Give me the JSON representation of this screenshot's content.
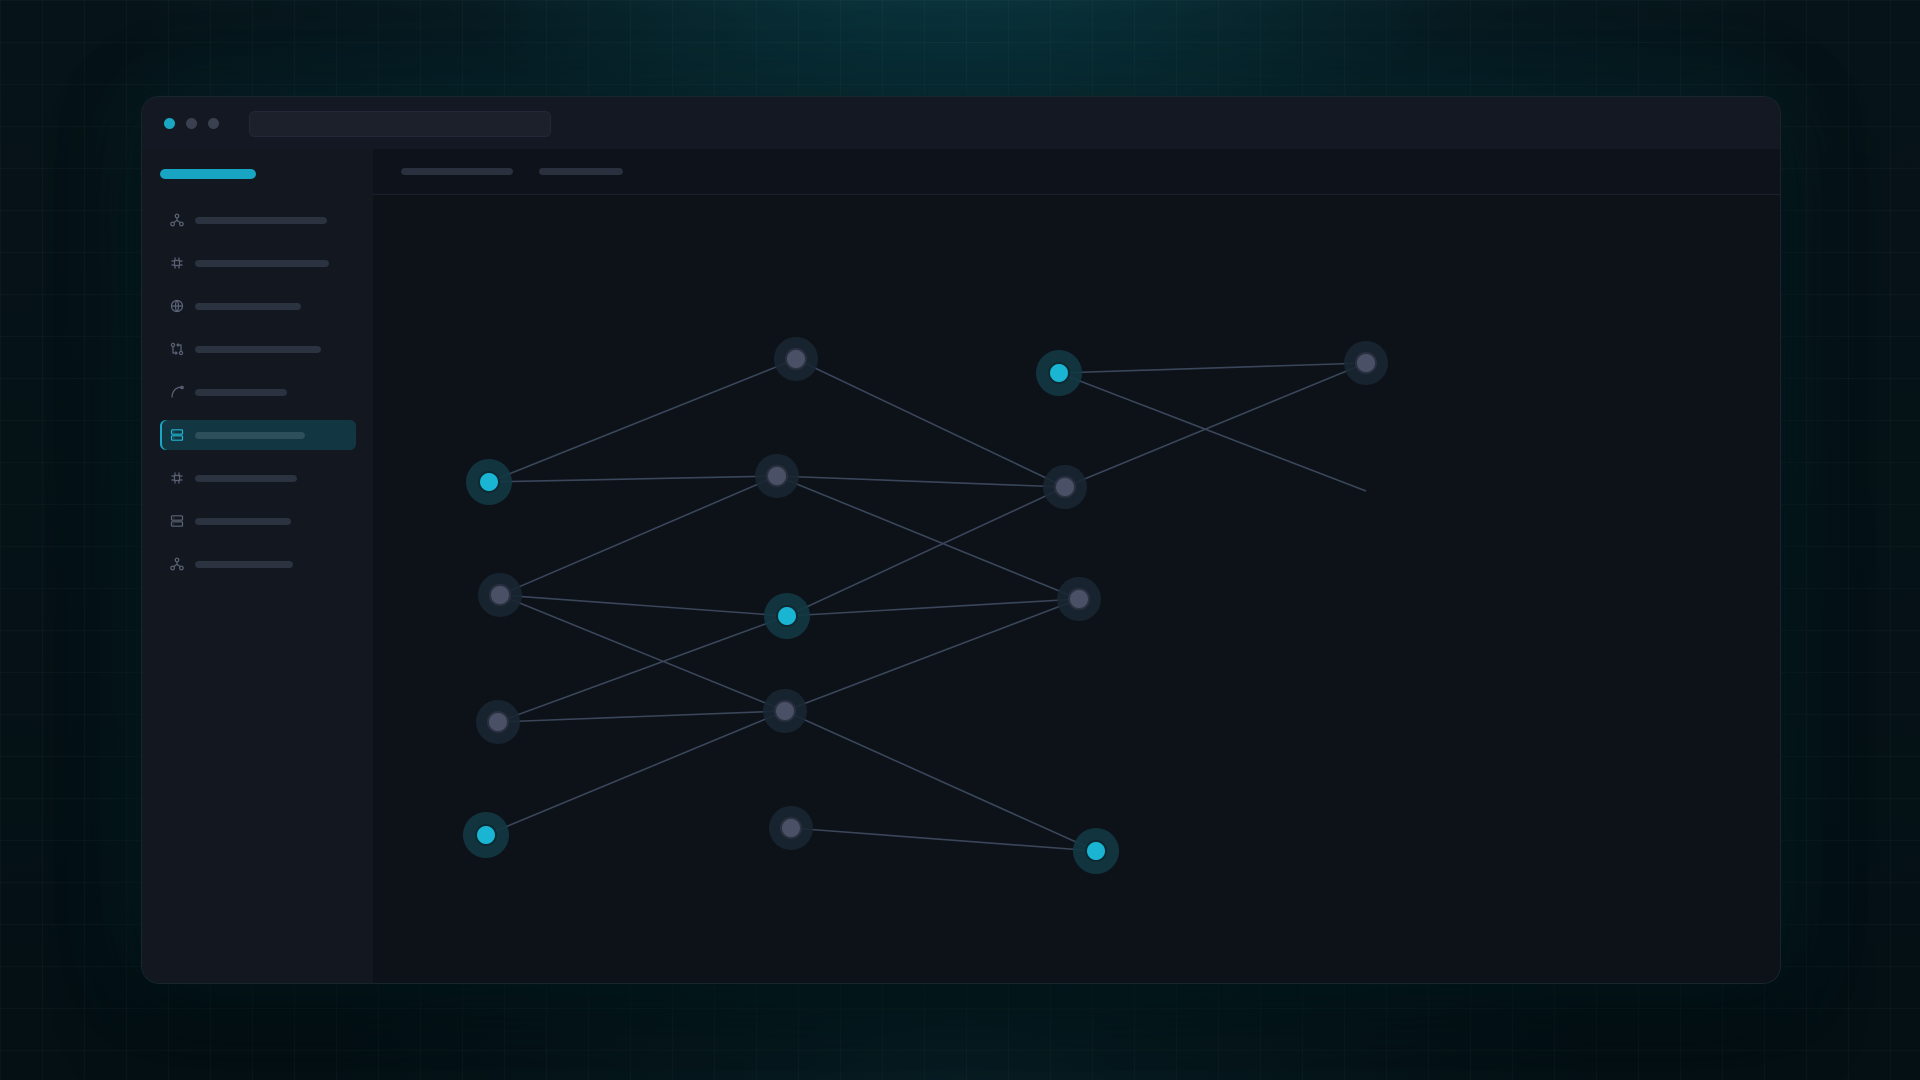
{
  "window": {
    "traffic_lights": [
      "accent",
      "neutral",
      "neutral"
    ],
    "address_bar": {
      "value": ""
    }
  },
  "toolbar": {
    "tabs": [
      {
        "label": ""
      },
      {
        "label": ""
      }
    ]
  },
  "sidebar": {
    "brand": "",
    "active_index": 5,
    "items": [
      {
        "label": "",
        "icon": "network-icon"
      },
      {
        "label": "",
        "icon": "plugin-icon"
      },
      {
        "label": "",
        "icon": "globe-icon"
      },
      {
        "label": "",
        "icon": "git-compare-icon"
      },
      {
        "label": "",
        "icon": "curve-icon"
      },
      {
        "label": "",
        "icon": "server-icon"
      },
      {
        "label": "",
        "icon": "plugin-icon"
      },
      {
        "label": "",
        "icon": "server-icon"
      },
      {
        "label": "",
        "icon": "network-icon"
      }
    ]
  },
  "graph": {
    "nodes": [
      {
        "id": "n1",
        "kind": "muted"
      },
      {
        "id": "n2",
        "kind": "accent"
      },
      {
        "id": "n3",
        "kind": "muted"
      },
      {
        "id": "n4",
        "kind": "accent"
      },
      {
        "id": "n5",
        "kind": "muted"
      },
      {
        "id": "n6",
        "kind": "muted"
      },
      {
        "id": "n7",
        "kind": "muted"
      },
      {
        "id": "n8",
        "kind": "accent"
      },
      {
        "id": "n9",
        "kind": "muted"
      },
      {
        "id": "n10",
        "kind": "muted"
      },
      {
        "id": "n11",
        "kind": "muted"
      },
      {
        "id": "n12",
        "kind": "accent"
      },
      {
        "id": "n13",
        "kind": "muted"
      },
      {
        "id": "n14",
        "kind": "accent"
      },
      {
        "id": "n15",
        "kind": "open-end"
      }
    ],
    "edges": [
      [
        "n4",
        "n1"
      ],
      [
        "n1",
        "n6"
      ],
      [
        "n2",
        "n3"
      ],
      [
        "n2",
        "n15"
      ],
      [
        "n3",
        "n6"
      ],
      [
        "n4",
        "n5"
      ],
      [
        "n5",
        "n6"
      ],
      [
        "n5",
        "n7"
      ],
      [
        "n5",
        "n9"
      ],
      [
        "n7",
        "n8"
      ],
      [
        "n8",
        "n6"
      ],
      [
        "n8",
        "n9"
      ],
      [
        "n7",
        "n11"
      ],
      [
        "n10",
        "n8"
      ],
      [
        "n10",
        "n11"
      ],
      [
        "n11",
        "n9"
      ],
      [
        "n12",
        "n11"
      ],
      [
        "n11",
        "n14"
      ],
      [
        "n13",
        "n14"
      ]
    ]
  },
  "colors": {
    "accent": "#19b5d3",
    "node_muted": "#4a5166",
    "edge": "#3a465a",
    "halo_accent": "#123844",
    "halo_muted": "#182732"
  }
}
